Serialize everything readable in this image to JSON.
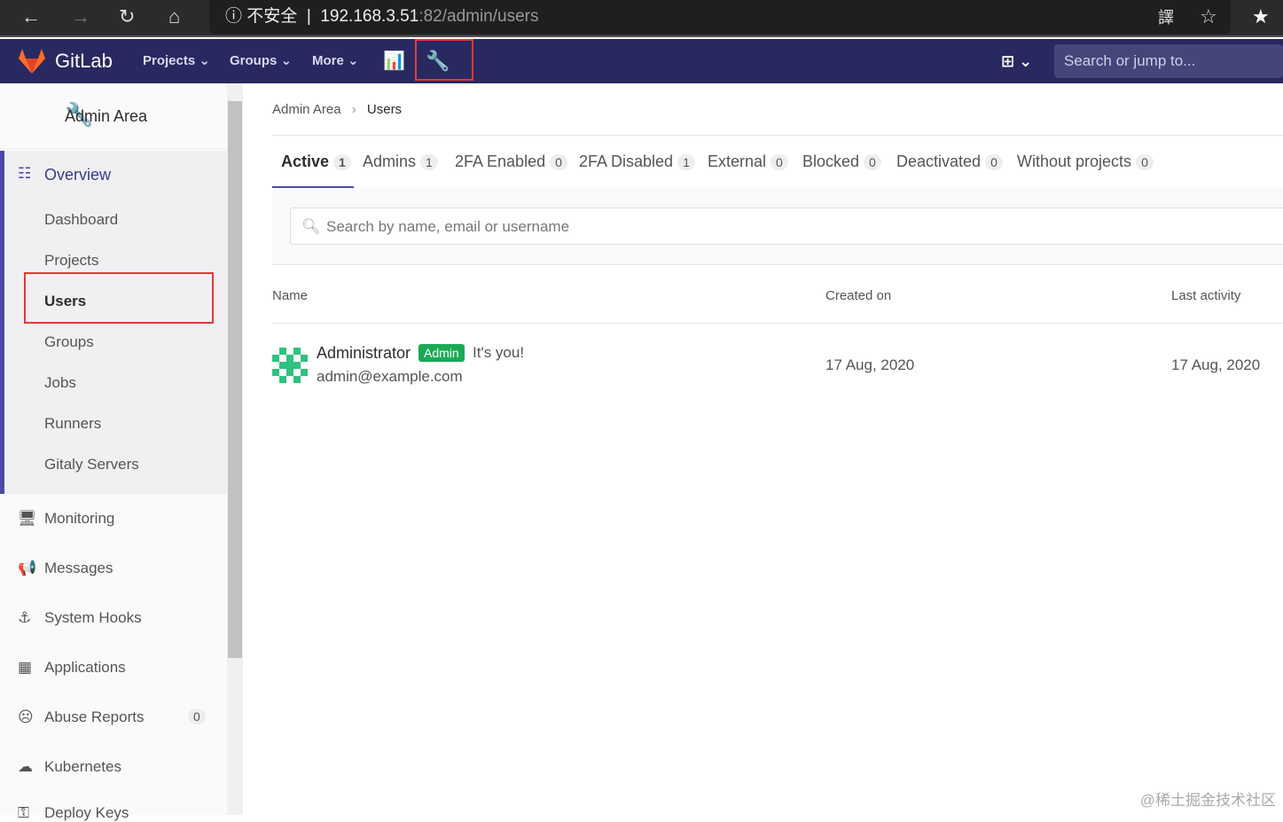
{
  "browser": {
    "security": "不安全",
    "url_host": "192.168.3.51",
    "url_rest": ":82/admin/users"
  },
  "nav": {
    "brand": "GitLab",
    "projects": "Projects",
    "groups": "Groups",
    "more": "More",
    "search_placeholder": "Search or jump to..."
  },
  "sidebar": {
    "title": "Admin Area",
    "overview": "Overview",
    "sub": [
      "Dashboard",
      "Projects",
      "Users",
      "Groups",
      "Jobs",
      "Runners",
      "Gitaly Servers"
    ],
    "items": [
      {
        "label": "Monitoring",
        "icon": "monitor-icon"
      },
      {
        "label": "Messages",
        "icon": "megaphone-icon"
      },
      {
        "label": "System Hooks",
        "icon": "anchor-icon"
      },
      {
        "label": "Applications",
        "icon": "apps-icon"
      },
      {
        "label": "Abuse Reports",
        "icon": "sad-face-icon",
        "count": "0"
      },
      {
        "label": "Kubernetes",
        "icon": "cloud-gear-icon"
      },
      {
        "label": "Deploy Keys",
        "icon": "key-icon"
      }
    ]
  },
  "breadcrumb": {
    "parent": "Admin Area",
    "current": "Users"
  },
  "tabs": [
    {
      "label": "Active",
      "count": "1"
    },
    {
      "label": "Admins",
      "count": "1"
    },
    {
      "label": "2FA Enabled",
      "count": "0"
    },
    {
      "label": "2FA Disabled",
      "count": "1"
    },
    {
      "label": "External",
      "count": "0"
    },
    {
      "label": "Blocked",
      "count": "0"
    },
    {
      "label": "Deactivated",
      "count": "0"
    },
    {
      "label": "Without projects",
      "count": "0"
    }
  ],
  "filter": {
    "placeholder": "Search by name, email or username"
  },
  "table": {
    "headers": [
      "Name",
      "Created on",
      "Last activity"
    ],
    "rows": [
      {
        "name": "Administrator",
        "badge": "Admin",
        "note": "It's you!",
        "email": "admin@example.com",
        "created": "17 Aug, 2020",
        "last": "17 Aug, 2020"
      }
    ]
  },
  "watermark": "@稀土掘金技术社区"
}
